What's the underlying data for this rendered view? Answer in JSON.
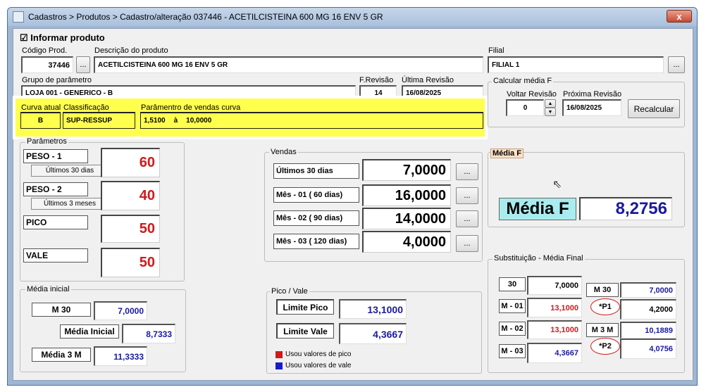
{
  "window": {
    "title": "Cadastros > Produtos > Cadastro/alteração  037446 - ACETILCISTEINA 600 MG 16 ENV 5 GR",
    "close": "x"
  },
  "informar": {
    "label": "Informar produto",
    "checked": "☑"
  },
  "product": {
    "code_label": "Código Prod.",
    "code": "37446",
    "desc_label": "Descrição do  produto",
    "desc": "ACETILCISTEINA 600 MG 16 ENV 5 GR",
    "filial_label": "Filial",
    "filial": "FILIAL 1",
    "ellipsis": "..."
  },
  "grupo": {
    "label": "Grupo de parâmetro",
    "value": "LOJA 001 - GENERICO - B",
    "frev_label": "F.Revisão",
    "frev": "14",
    "ultima_label": "Última Revisão",
    "ultima": "16/08/2025"
  },
  "calcular": {
    "title": "Calcular média F",
    "voltar_label": "Voltar Revisão",
    "voltar": "0",
    "proxima_label": "Próxima Revisão",
    "proxima": "16/08/2025",
    "recalcular": "Recalcular"
  },
  "curva": {
    "atual_label": "Curva atual",
    "atual": "B",
    "class_label": "Classificação",
    "class": "SUP-RESSUP",
    "param_label": "Parâmentro de vendas curva",
    "param_from": "1,5100",
    "param_sep": "à",
    "param_to": "10,0000"
  },
  "parametros": {
    "title": "Parâmetros",
    "items": [
      {
        "label": "PESO - 1",
        "sub": "Últimos 30 dias",
        "value": "60"
      },
      {
        "label": "PESO - 2",
        "sub": "Últimos 3 meses",
        "value": "40"
      },
      {
        "label": "PICO",
        "sub": "",
        "value": "50"
      },
      {
        "label": "VALE",
        "sub": "",
        "value": "50"
      }
    ]
  },
  "vendas": {
    "title": "Vendas",
    "rows": [
      {
        "label": "Últimos 30 dias",
        "value": "7,0000"
      },
      {
        "label": "Mês - 01 ( 60 dias)",
        "value": "16,0000"
      },
      {
        "label": "Mês - 02 ( 90 dias)",
        "value": "14,0000"
      },
      {
        "label": "Mês - 03 ( 120 dias)",
        "value": "4,0000"
      }
    ]
  },
  "mediaf": {
    "title": "Média F",
    "label": "Média F",
    "value": "8,2756"
  },
  "media_inicial": {
    "title": "Média inicial",
    "m30_label": "M 30",
    "m30": "7,0000",
    "mi_label": "Média Inicial",
    "mi": "8,7333",
    "m3m_label": "Média 3 M",
    "m3m": "11,3333"
  },
  "pico_vale": {
    "title": "Pico / Vale",
    "pico_label": "Limite Pico",
    "pico": "13,1000",
    "vale_label": "Limite Vale",
    "vale": "4,3667",
    "legend_pico": "Usou valores de pico",
    "legend_vale": "Usou valores de vale",
    "color_pico": "#d01a1a",
    "color_vale": "#1a1ad0"
  },
  "substituicao": {
    "title": "Substituição - Média Final",
    "left": [
      {
        "label": "30",
        "value": "7,0000",
        "color": "black"
      },
      {
        "label": "M - 01",
        "value": "13,1000",
        "color": "red"
      },
      {
        "label": "M - 02",
        "value": "13,1000",
        "color": "red"
      },
      {
        "label": "M - 03",
        "value": "4,3667",
        "color": "blue"
      }
    ],
    "right": [
      {
        "label": "M 30",
        "value": "7,0000"
      },
      {
        "label": "*P1",
        "value": "4,2000"
      },
      {
        "label": "M 3 M",
        "value": "10,1889"
      },
      {
        "label": "*P2",
        "value": "4,0756"
      }
    ]
  }
}
